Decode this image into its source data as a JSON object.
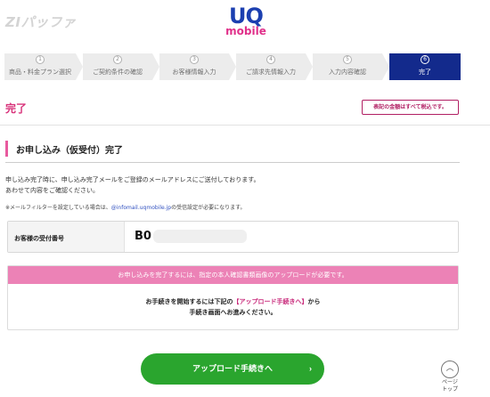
{
  "watermark": "ZIパッファ",
  "logo": {
    "top": "UQ",
    "bottom": "mobile"
  },
  "steps": [
    {
      "num": "1",
      "label": "商品・料金プラン選択"
    },
    {
      "num": "2",
      "label": "ご契約条件の確認"
    },
    {
      "num": "3",
      "label": "お客様情報入力"
    },
    {
      "num": "4",
      "label": "ご請求先情報入力"
    },
    {
      "num": "5",
      "label": "入力内容確認"
    },
    {
      "num": "6",
      "label": "完了"
    }
  ],
  "page": {
    "title": "完了",
    "tax_note": "表記の金額はすべて税込です。"
  },
  "section": {
    "title": "お申し込み（仮受付）完了"
  },
  "message": {
    "line1": "申し込み完了時に、申し込み完了メールをご登録のメールアドレスにご送付しております。",
    "line2": "あわせて内容をご確認ください。",
    "note_pre": "※メールフィルターを設定している場合は、",
    "note_mail": "@infomail.uqmobile.jp",
    "note_post": "の受信設定が必要になります。"
  },
  "receipt": {
    "label": "お客様の受付番号",
    "value": "B0"
  },
  "notice": {
    "header": "お申し込みを完了するには、指定の本人確認書類画像のアップロードが必要です。",
    "body_pre": "お手続きを開始するには下記の",
    "body_highlight": "【アップロード手続きへ】",
    "body_post": "から",
    "body_line2": "手続き画面へお進みください。"
  },
  "buttons": {
    "upload": "アップロード手続きへ",
    "upload_chevron": "›"
  },
  "page_top": {
    "arrow": "︿",
    "line1": "ページ",
    "line2": "トップ"
  },
  "colors": {
    "brand_blue": "#132a8c",
    "brand_pink": "#e0308a",
    "notice_pink": "#ec82b6",
    "button_green": "#2aa52e"
  }
}
